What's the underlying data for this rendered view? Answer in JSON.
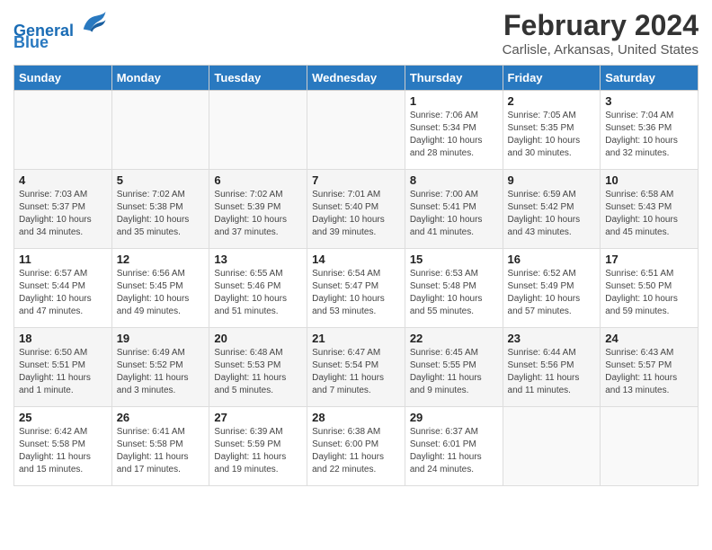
{
  "header": {
    "logo_line1": "General",
    "logo_line2": "Blue",
    "title": "February 2024",
    "subtitle": "Carlisle, Arkansas, United States"
  },
  "days_of_week": [
    "Sunday",
    "Monday",
    "Tuesday",
    "Wednesday",
    "Thursday",
    "Friday",
    "Saturday"
  ],
  "weeks": [
    [
      {
        "day": "",
        "info": ""
      },
      {
        "day": "",
        "info": ""
      },
      {
        "day": "",
        "info": ""
      },
      {
        "day": "",
        "info": ""
      },
      {
        "day": "1",
        "info": "Sunrise: 7:06 AM\nSunset: 5:34 PM\nDaylight: 10 hours\nand 28 minutes."
      },
      {
        "day": "2",
        "info": "Sunrise: 7:05 AM\nSunset: 5:35 PM\nDaylight: 10 hours\nand 30 minutes."
      },
      {
        "day": "3",
        "info": "Sunrise: 7:04 AM\nSunset: 5:36 PM\nDaylight: 10 hours\nand 32 minutes."
      }
    ],
    [
      {
        "day": "4",
        "info": "Sunrise: 7:03 AM\nSunset: 5:37 PM\nDaylight: 10 hours\nand 34 minutes."
      },
      {
        "day": "5",
        "info": "Sunrise: 7:02 AM\nSunset: 5:38 PM\nDaylight: 10 hours\nand 35 minutes."
      },
      {
        "day": "6",
        "info": "Sunrise: 7:02 AM\nSunset: 5:39 PM\nDaylight: 10 hours\nand 37 minutes."
      },
      {
        "day": "7",
        "info": "Sunrise: 7:01 AM\nSunset: 5:40 PM\nDaylight: 10 hours\nand 39 minutes."
      },
      {
        "day": "8",
        "info": "Sunrise: 7:00 AM\nSunset: 5:41 PM\nDaylight: 10 hours\nand 41 minutes."
      },
      {
        "day": "9",
        "info": "Sunrise: 6:59 AM\nSunset: 5:42 PM\nDaylight: 10 hours\nand 43 minutes."
      },
      {
        "day": "10",
        "info": "Sunrise: 6:58 AM\nSunset: 5:43 PM\nDaylight: 10 hours\nand 45 minutes."
      }
    ],
    [
      {
        "day": "11",
        "info": "Sunrise: 6:57 AM\nSunset: 5:44 PM\nDaylight: 10 hours\nand 47 minutes."
      },
      {
        "day": "12",
        "info": "Sunrise: 6:56 AM\nSunset: 5:45 PM\nDaylight: 10 hours\nand 49 minutes."
      },
      {
        "day": "13",
        "info": "Sunrise: 6:55 AM\nSunset: 5:46 PM\nDaylight: 10 hours\nand 51 minutes."
      },
      {
        "day": "14",
        "info": "Sunrise: 6:54 AM\nSunset: 5:47 PM\nDaylight: 10 hours\nand 53 minutes."
      },
      {
        "day": "15",
        "info": "Sunrise: 6:53 AM\nSunset: 5:48 PM\nDaylight: 10 hours\nand 55 minutes."
      },
      {
        "day": "16",
        "info": "Sunrise: 6:52 AM\nSunset: 5:49 PM\nDaylight: 10 hours\nand 57 minutes."
      },
      {
        "day": "17",
        "info": "Sunrise: 6:51 AM\nSunset: 5:50 PM\nDaylight: 10 hours\nand 59 minutes."
      }
    ],
    [
      {
        "day": "18",
        "info": "Sunrise: 6:50 AM\nSunset: 5:51 PM\nDaylight: 11 hours\nand 1 minute."
      },
      {
        "day": "19",
        "info": "Sunrise: 6:49 AM\nSunset: 5:52 PM\nDaylight: 11 hours\nand 3 minutes."
      },
      {
        "day": "20",
        "info": "Sunrise: 6:48 AM\nSunset: 5:53 PM\nDaylight: 11 hours\nand 5 minutes."
      },
      {
        "day": "21",
        "info": "Sunrise: 6:47 AM\nSunset: 5:54 PM\nDaylight: 11 hours\nand 7 minutes."
      },
      {
        "day": "22",
        "info": "Sunrise: 6:45 AM\nSunset: 5:55 PM\nDaylight: 11 hours\nand 9 minutes."
      },
      {
        "day": "23",
        "info": "Sunrise: 6:44 AM\nSunset: 5:56 PM\nDaylight: 11 hours\nand 11 minutes."
      },
      {
        "day": "24",
        "info": "Sunrise: 6:43 AM\nSunset: 5:57 PM\nDaylight: 11 hours\nand 13 minutes."
      }
    ],
    [
      {
        "day": "25",
        "info": "Sunrise: 6:42 AM\nSunset: 5:58 PM\nDaylight: 11 hours\nand 15 minutes."
      },
      {
        "day": "26",
        "info": "Sunrise: 6:41 AM\nSunset: 5:58 PM\nDaylight: 11 hours\nand 17 minutes."
      },
      {
        "day": "27",
        "info": "Sunrise: 6:39 AM\nSunset: 5:59 PM\nDaylight: 11 hours\nand 19 minutes."
      },
      {
        "day": "28",
        "info": "Sunrise: 6:38 AM\nSunset: 6:00 PM\nDaylight: 11 hours\nand 22 minutes."
      },
      {
        "day": "29",
        "info": "Sunrise: 6:37 AM\nSunset: 6:01 PM\nDaylight: 11 hours\nand 24 minutes."
      },
      {
        "day": "",
        "info": ""
      },
      {
        "day": "",
        "info": ""
      }
    ]
  ]
}
